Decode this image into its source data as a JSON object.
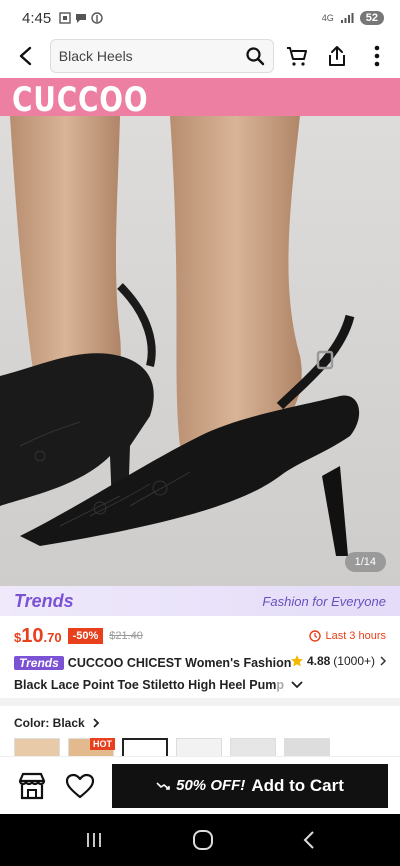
{
  "status_bar": {
    "time": "4:45",
    "network": "4G",
    "battery": "52"
  },
  "search": {
    "value": "Black Heels"
  },
  "hero": {
    "brand": "CUCCOO",
    "counter": "1/14"
  },
  "trends": {
    "logo": "Trends",
    "tagline": "Fashion for Everyone"
  },
  "price": {
    "currency": "$",
    "whole": "10",
    "cents": ".70",
    "discount": "-50%",
    "original": "$21.40",
    "timer": "Last 3 hours"
  },
  "product": {
    "badge": "Trends",
    "title_line1": "CUCCOO CHICEST Women's Fashion",
    "title_line2": "Black Lace Point Toe Stiletto High Heel Pum",
    "title_fade": "p",
    "rating": "4.88",
    "reviews": "(1000+)"
  },
  "color": {
    "label": "Color: Black",
    "hot": "HOT"
  },
  "cart": {
    "offer": "50% OFF!",
    "label": "Add to Cart"
  },
  "colors": {
    "accent": "#e8401c",
    "trends": "#7b52d4",
    "brand_strip": "#ec7fa2"
  }
}
